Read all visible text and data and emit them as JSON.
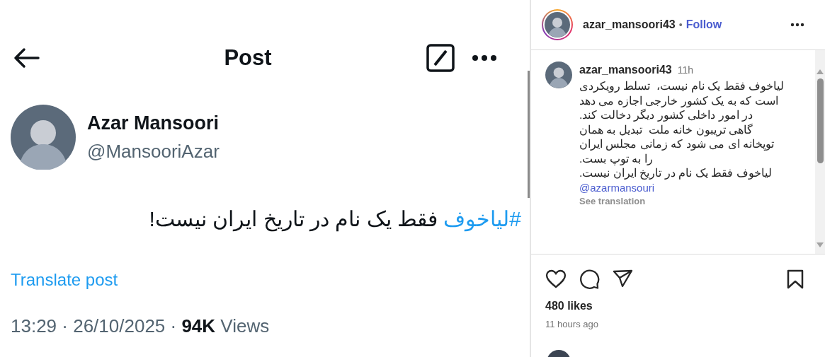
{
  "post": {
    "title": "Post",
    "author": {
      "name": "Azar Mansoori",
      "handle": "@MansooriAzar"
    },
    "hashtag": "#لیاخوف",
    "body": "فقط یک نام در تاریخ ایران نیست!",
    "translate": "Translate post",
    "meta": "13:29 · 26/10/2025 · **94K** Views"
  },
  "instagram": {
    "header": {
      "username": "azar_mansoori43",
      "separator": "•",
      "follow": "Follow"
    },
    "caption": {
      "username": "azar_mansoori43",
      "time": "11h",
      "text": "لیاخوف فقط یک نام نیست،  تسلط رویکردی\nاست که به یک کشور خارجی اجازه می دهد\n در امور داخلی کشور دیگر دخالت کند.\nگاهی تریبون خانه ملت  تبدیل به همان\nتوپخانه ای می شود که زمانی مجلس ایران\nرا به توپ بست.\nلیاخوف فقط یک نام در تاریخ ایران نیست.",
      "mention": "@azarmansouri",
      "see_translation": "See translation"
    },
    "likes": "480 likes",
    "posted": "11 hours ago"
  }
}
